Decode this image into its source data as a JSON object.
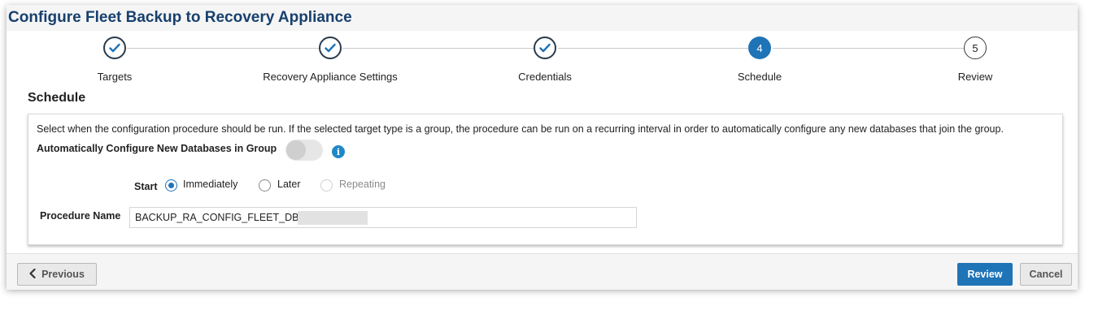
{
  "window": {
    "title": "Configure Fleet Backup to Recovery Appliance"
  },
  "train": {
    "steps": [
      {
        "label": "Targets",
        "state": "complete",
        "marker": "✓"
      },
      {
        "label": "Recovery Appliance Settings",
        "state": "complete",
        "marker": "✓"
      },
      {
        "label": "Credentials",
        "state": "complete",
        "marker": "✓"
      },
      {
        "label": "Schedule",
        "state": "current",
        "marker": "4"
      },
      {
        "label": "Review",
        "state": "pending",
        "marker": "5"
      }
    ]
  },
  "schedule": {
    "heading": "Schedule",
    "description": "Select when the configuration procedure should be run. If the selected target type is a group, the procedure can be run on a recurring interval in order to automatically configure any new databases that join the group.",
    "auto_configure_label": "Automatically Configure New Databases in Group",
    "auto_configure_enabled": false,
    "info_icon": "i",
    "start_label": "Start",
    "start_options": [
      {
        "label": "Immediately",
        "selected": true,
        "disabled": false
      },
      {
        "label": "Later",
        "selected": false,
        "disabled": false
      },
      {
        "label": "Repeating",
        "selected": false,
        "disabled": true
      }
    ],
    "procedure_name_label": "Procedure Name",
    "procedure_name_value": "BACKUP_RA_CONFIG_FLEET_DB_1"
  },
  "footer": {
    "previous_label": "Previous",
    "previous_icon": "‹",
    "review_label": "Review",
    "cancel_label": "Cancel"
  },
  "colors": {
    "title": "#17406d",
    "accent": "#1f73b7",
    "info": "#1f88c7"
  }
}
